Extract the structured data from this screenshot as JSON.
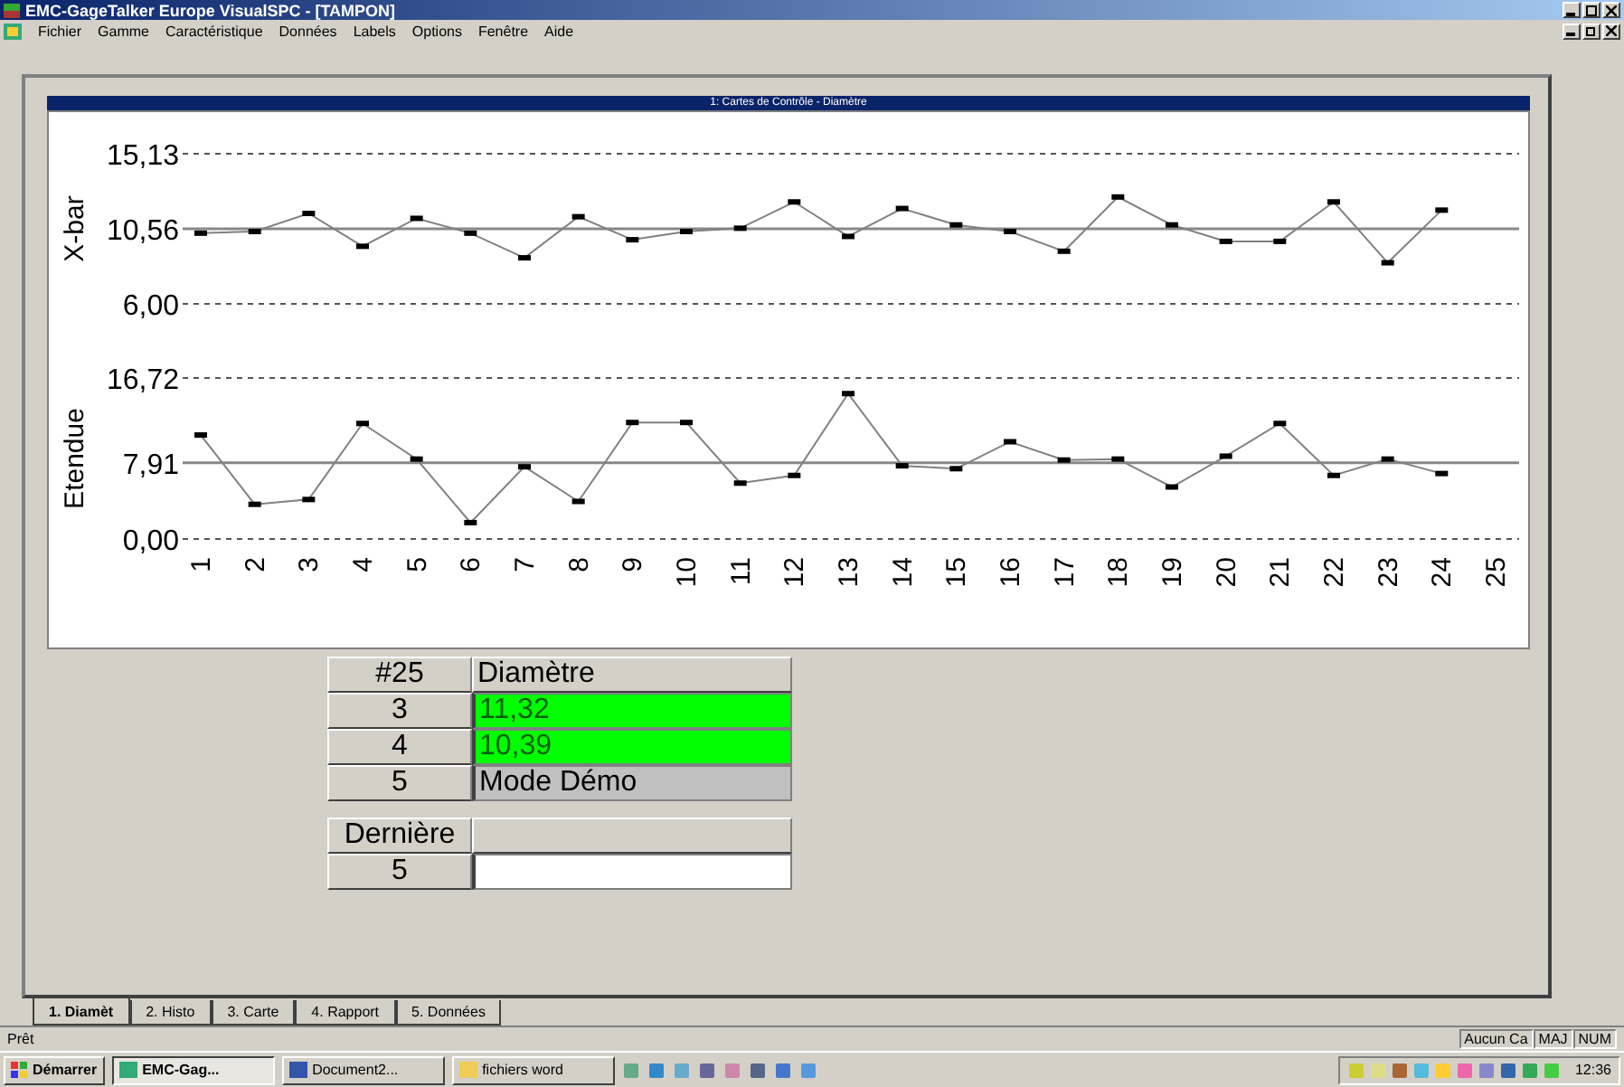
{
  "window": {
    "title": "EMC-GageTalker Europe VisualSPC - [TAMPON]"
  },
  "menu": [
    "Fichier",
    "Gamme",
    "Caractéristique",
    "Données",
    "Labels",
    "Options",
    "Fenêtre",
    "Aide"
  ],
  "chart_window": {
    "title": "1: Cartes de Contrôle - Diamètre",
    "charts": [
      {
        "chart_data": {
          "type": "line",
          "ylabel": "X-bar",
          "ylim": [
            6.0,
            15.13
          ],
          "yticks": [
            {
              "value": 15.13,
              "label": "15,13"
            },
            {
              "value": 10.56,
              "label": "10,56"
            },
            {
              "value": 6.0,
              "label": "6,00"
            }
          ],
          "ref_lines": [
            {
              "axis": "y",
              "value": 10.56
            }
          ],
          "series": [
            {
              "color": "#808080",
              "marker": "square",
              "values": [
                10.3,
                10.4,
                11.5,
                9.5,
                11.2,
                10.3,
                8.8,
                11.3,
                9.9,
                10.4,
                10.6,
                12.2,
                10.1,
                11.8,
                10.8,
                10.4,
                9.2,
                12.5,
                10.8,
                9.8,
                9.8,
                12.2,
                8.5,
                11.7,
                null
              ]
            }
          ]
        }
      },
      {
        "chart_data": {
          "type": "line",
          "ylabel": "Etendue",
          "ylim": [
            0.0,
            16.72
          ],
          "yticks": [
            {
              "value": 16.72,
              "label": "16,72"
            },
            {
              "value": 7.91,
              "label": "7,91"
            },
            {
              "value": 0.0,
              "label": "0,00"
            }
          ],
          "ref_lines": [
            {
              "axis": "y",
              "value": 7.91
            }
          ],
          "categories": [
            "1",
            "2",
            "3",
            "4",
            "5",
            "6",
            "7",
            "8",
            "9",
            "10",
            "11",
            "12",
            "13",
            "14",
            "15",
            "16",
            "17",
            "18",
            "19",
            "20",
            "21",
            "22",
            "23",
            "24",
            "25"
          ],
          "series": [
            {
              "color": "#808080",
              "marker": "square",
              "values": [
                10.8,
                3.6,
                4.1,
                12.0,
                8.3,
                1.7,
                7.5,
                3.9,
                12.1,
                12.1,
                5.8,
                6.6,
                15.1,
                7.6,
                7.3,
                10.1,
                8.2,
                8.3,
                5.4,
                8.6,
                12.0,
                6.6,
                8.3,
                6.8,
                null
              ]
            }
          ]
        }
      }
    ]
  },
  "table": {
    "columns": [
      "#25",
      "Diamètre"
    ],
    "rows": [
      {
        "label": "3",
        "value": "11,32",
        "color": "#00ff00"
      },
      {
        "label": "4",
        "value": "10,39",
        "color": "#00ff00"
      },
      {
        "label": "5",
        "value": "Mode Démo",
        "color": "#c0c0c0"
      }
    ]
  },
  "last_table": {
    "columns": [
      "Dernière"
    ],
    "rows": [
      {
        "label": "5"
      }
    ]
  },
  "tabs": [
    {
      "label": "1. Diamèt",
      "selected": true
    },
    {
      "label": "2. Histo",
      "selected": false
    },
    {
      "label": "3. Carte",
      "selected": false
    },
    {
      "label": "4. Rapport",
      "selected": false
    },
    {
      "label": "5. Données",
      "selected": false
    }
  ],
  "status_bar": {
    "message": "Prêt",
    "panes": [
      "Aucun Ca",
      "MAJ",
      "NUM"
    ]
  },
  "taskbar": {
    "start": "Démarrer",
    "buttons": [
      {
        "label": "EMC-Gag...",
        "selected": true
      },
      {
        "label": "Document2...",
        "selected": false
      },
      {
        "label": "fichiers word",
        "selected": false
      }
    ],
    "clock": "12:36"
  }
}
